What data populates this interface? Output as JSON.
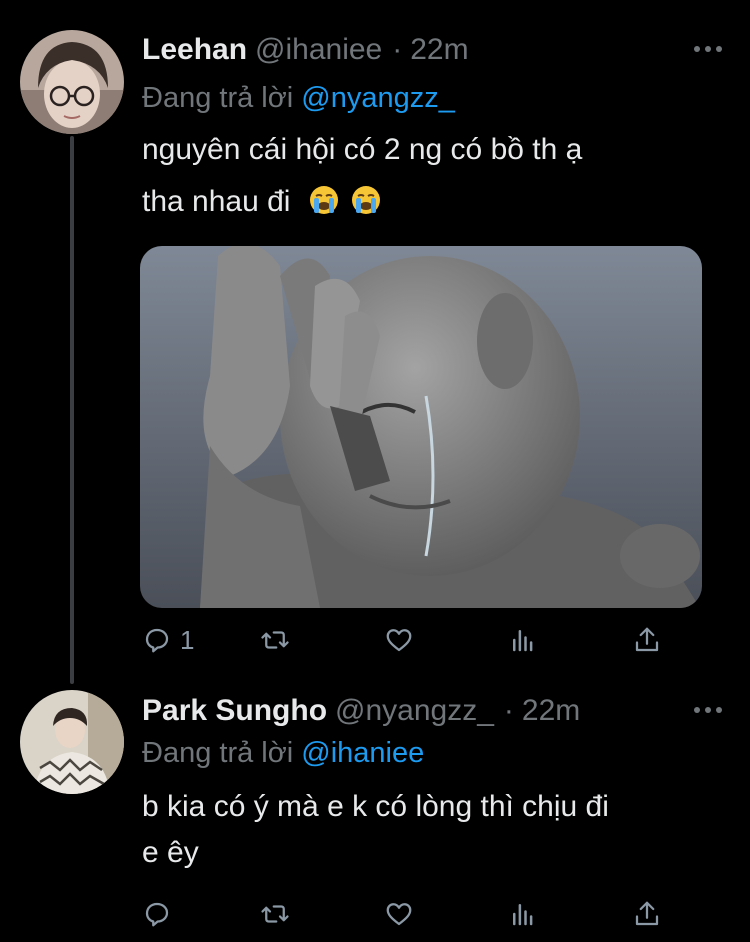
{
  "tweets": [
    {
      "name": "Leehan",
      "handle": "@ihaniee",
      "separator": "·",
      "time": "22m",
      "replying_prefix": "Đang trả lời",
      "replying_to": "@nyangzz_",
      "text_line1": "nguyên cái hội có 2 ng có bồ th ạ",
      "text_line2": "tha nhau đi",
      "emojis": [
        "loudly-crying-face",
        "loudly-crying-face"
      ],
      "reply_count": "1"
    },
    {
      "name": "Park Sungho",
      "handle": "@nyangzz_",
      "separator": "·",
      "time": "22m",
      "replying_prefix": "Đang trả lời",
      "replying_to": "@ihaniee",
      "text_line1": "b kia có ý mà e k có lòng thì chịu đi",
      "text_line2": "e êy",
      "reply_count": ""
    }
  ],
  "colors": {
    "background": "#000000",
    "text": "#e7e9ea",
    "secondary": "#71767b",
    "accent": "#1d9bf0"
  },
  "icons": [
    "reply-icon",
    "retweet-icon",
    "like-icon",
    "analytics-icon",
    "share-icon",
    "more-icon"
  ]
}
